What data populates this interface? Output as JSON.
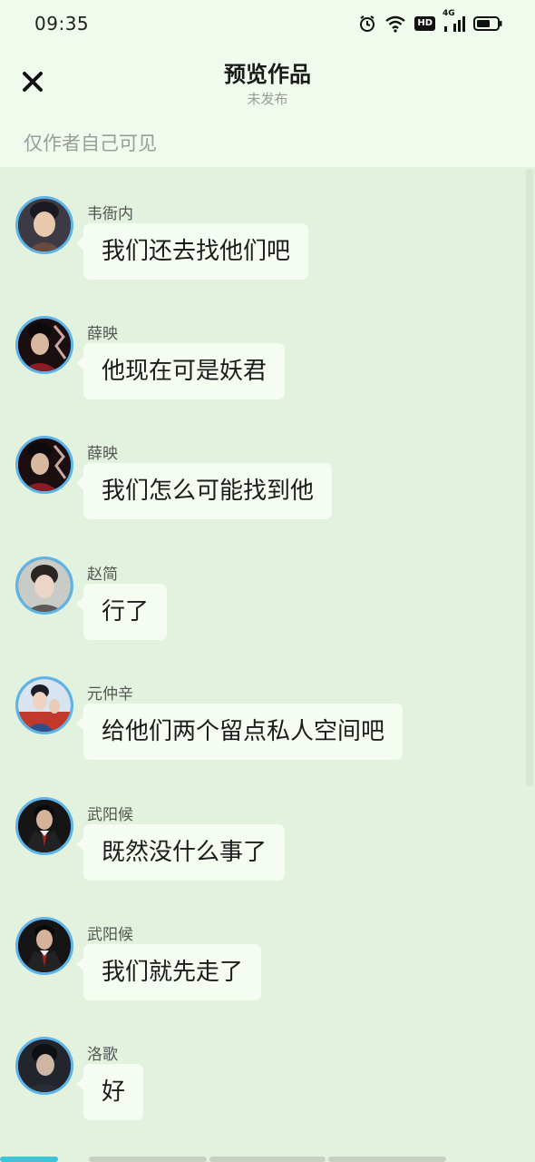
{
  "status_bar": {
    "time": "09:35",
    "icons": [
      "alarm-icon",
      "wifi-icon",
      "hd-icon",
      "cellular-4g-icon",
      "battery-icon"
    ],
    "hd_label": "HD",
    "network_label": "4G"
  },
  "header": {
    "close_icon": "close-icon",
    "title": "预览作品",
    "subtitle": "未发布",
    "visibility_note": "仅作者自己可见"
  },
  "messages": [
    {
      "sender": "韦衙内",
      "text": "我们还去找他们吧",
      "avatar": "avatar-1"
    },
    {
      "sender": "薛映",
      "text": "他现在可是妖君",
      "avatar": "avatar-2"
    },
    {
      "sender": "薛映",
      "text": "我们怎么可能找到他",
      "avatar": "avatar-2"
    },
    {
      "sender": "赵简",
      "text": "行了",
      "avatar": "avatar-3"
    },
    {
      "sender": "元仲辛",
      "text": "给他们两个留点私人空间吧",
      "avatar": "avatar-4"
    },
    {
      "sender": "武阳候",
      "text": "既然没什么事了",
      "avatar": "avatar-5"
    },
    {
      "sender": "武阳候",
      "text": "我们就先走了",
      "avatar": "avatar-5"
    },
    {
      "sender": "洛歌",
      "text": "好",
      "avatar": "avatar-6"
    }
  ],
  "colors": {
    "background": "#e3f2de",
    "header_background": "#f0fbee",
    "bubble": "#f5fcf2",
    "avatar_ring": "#5db4ea",
    "progress_active": "#3cc3d6",
    "progress_inactive": "#c8d0c6"
  }
}
